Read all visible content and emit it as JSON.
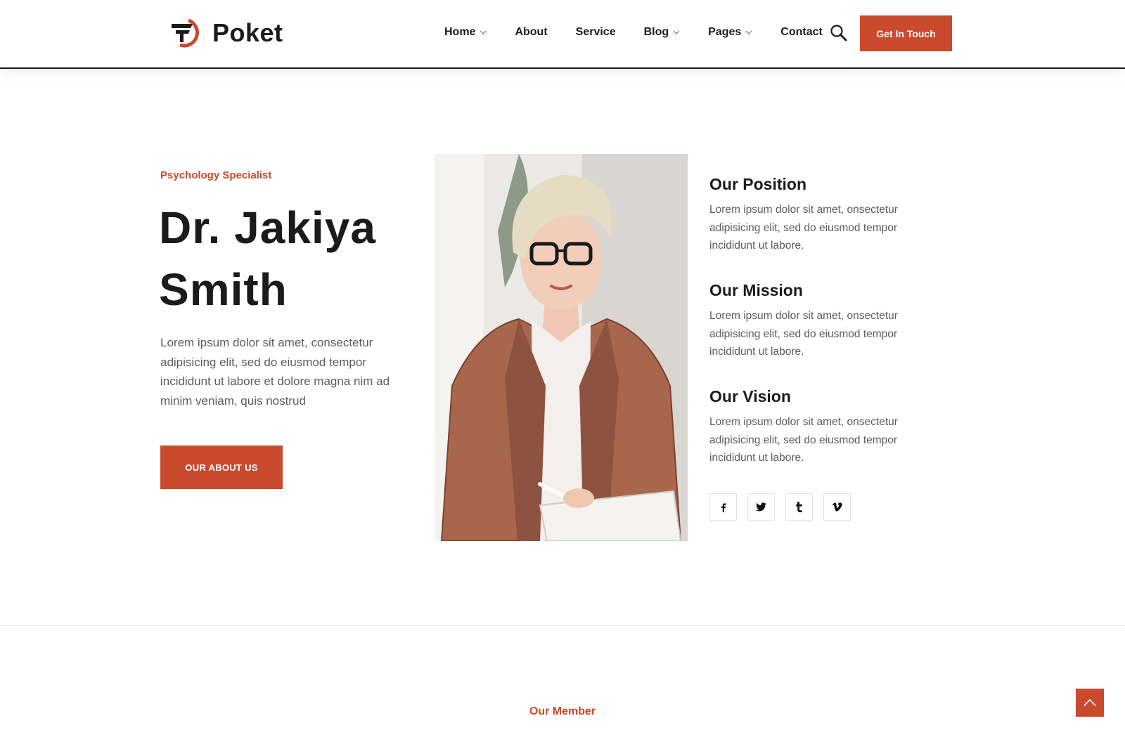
{
  "brand": {
    "name": "Poket",
    "accent": "#c94a2c"
  },
  "nav": {
    "items": [
      {
        "label": "Home",
        "dropdown": true
      },
      {
        "label": "About",
        "dropdown": false
      },
      {
        "label": "Service",
        "dropdown": false
      },
      {
        "label": "Blog",
        "dropdown": true
      },
      {
        "label": "Pages",
        "dropdown": true
      },
      {
        "label": "Contact",
        "dropdown": false
      }
    ],
    "search_icon": "search-icon",
    "cta_label": "Get In Touch"
  },
  "hero": {
    "eyebrow": "Psychology Specialist",
    "name_line1": "Dr. Jakiya",
    "name_line2": "Smith",
    "intro": "Lorem ipsum dolor sit amet, consectetur adipisicing elit, sed do eiusmod tempor incididunt ut labore et dolore magna nim ad minim veniam, quis nostrud",
    "button_label": "OUR ABOUT US"
  },
  "info_blocks": [
    {
      "title": "Our Position",
      "text": "Lorem ipsum dolor sit amet, onsectetur adipisicing elit, sed do eiusmod tempor incididunt ut labore."
    },
    {
      "title": "Our Mission",
      "text": "Lorem ipsum dolor sit amet, onsectetur adipisicing elit, sed do eiusmod tempor incididunt ut labore."
    },
    {
      "title": "Our Vision",
      "text": "Lorem ipsum dolor sit amet, onsectetur adipisicing elit, sed do eiusmod tempor incididunt ut labore."
    }
  ],
  "socials": [
    {
      "icon": "facebook-icon",
      "glyph": "f"
    },
    {
      "icon": "twitter-icon",
      "glyph": "🐦"
    },
    {
      "icon": "tumblr-icon",
      "glyph": "t"
    },
    {
      "icon": "vimeo-icon",
      "glyph": "v"
    }
  ],
  "members": {
    "eyebrow": "Our Member"
  },
  "scroll_top_icon": "chevron-up-icon"
}
